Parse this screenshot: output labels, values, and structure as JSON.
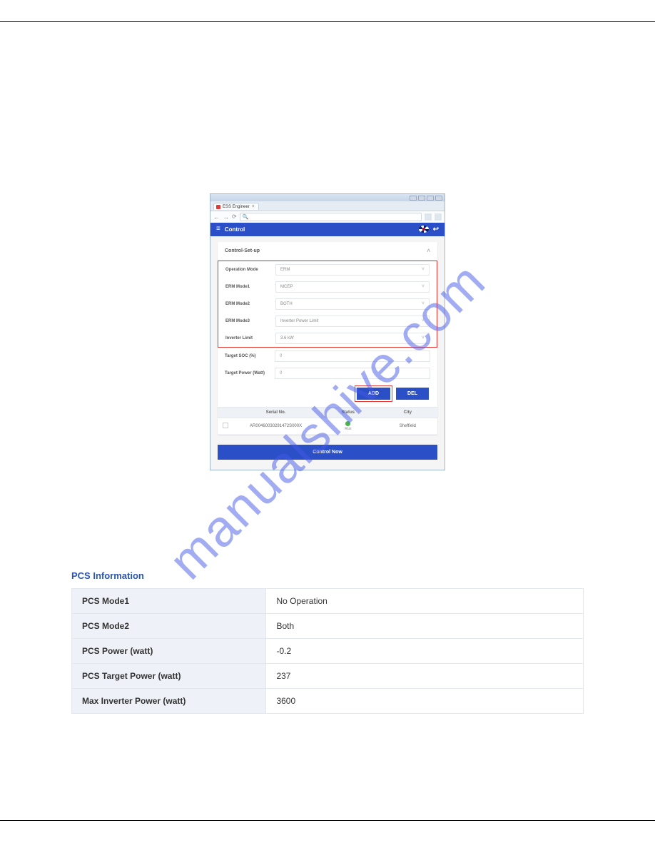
{
  "watermark": "manualshive.com",
  "browser": {
    "tab_title": "ESS Engineer",
    "tab_close": "×",
    "nav_back": "←",
    "nav_fwd": "→",
    "reload": "⟳"
  },
  "app": {
    "header_title": "Control",
    "logout_glyph": "↩"
  },
  "card": {
    "title": "Control-Set-up",
    "chevron": "˄"
  },
  "form": {
    "rows_red": [
      {
        "label": "Operation Mode",
        "value": "ERM",
        "dropdown": true
      },
      {
        "label": "ERM Mode1",
        "value": "MCEP",
        "dropdown": true
      },
      {
        "label": "ERM Mode2",
        "value": "BOTH",
        "dropdown": true
      },
      {
        "label": "ERM Mode3",
        "value": "Inverter Power Limit",
        "dropdown": true
      },
      {
        "label": "Inverter Limit",
        "value": "3.6 kW",
        "dropdown": true
      }
    ],
    "rows_plain": [
      {
        "label": "Target SOC (%)",
        "value": "0"
      },
      {
        "label": "Target Power (Watt)",
        "value": "0"
      }
    ]
  },
  "buttons": {
    "add": "ADD",
    "del": "DEL"
  },
  "table": {
    "headers": {
      "serial": "Serial No.",
      "status": "Status",
      "city": "City"
    },
    "row": {
      "serial": "AR00460030291472S000X",
      "status_text": "Run",
      "city": "Sheffield"
    }
  },
  "control_now": "Control Now",
  "pcs": {
    "title": "PCS Information",
    "rows": [
      {
        "label": "PCS Mode1",
        "value": "No Operation"
      },
      {
        "label": "PCS Mode2",
        "value": "Both"
      },
      {
        "label": "PCS Power (watt)",
        "value": "-0.2"
      },
      {
        "label": "PCS Target Power (watt)",
        "value": "237"
      },
      {
        "label": "Max Inverter Power (watt)",
        "value": "3600"
      }
    ]
  },
  "dropdown_chevron": "˅"
}
